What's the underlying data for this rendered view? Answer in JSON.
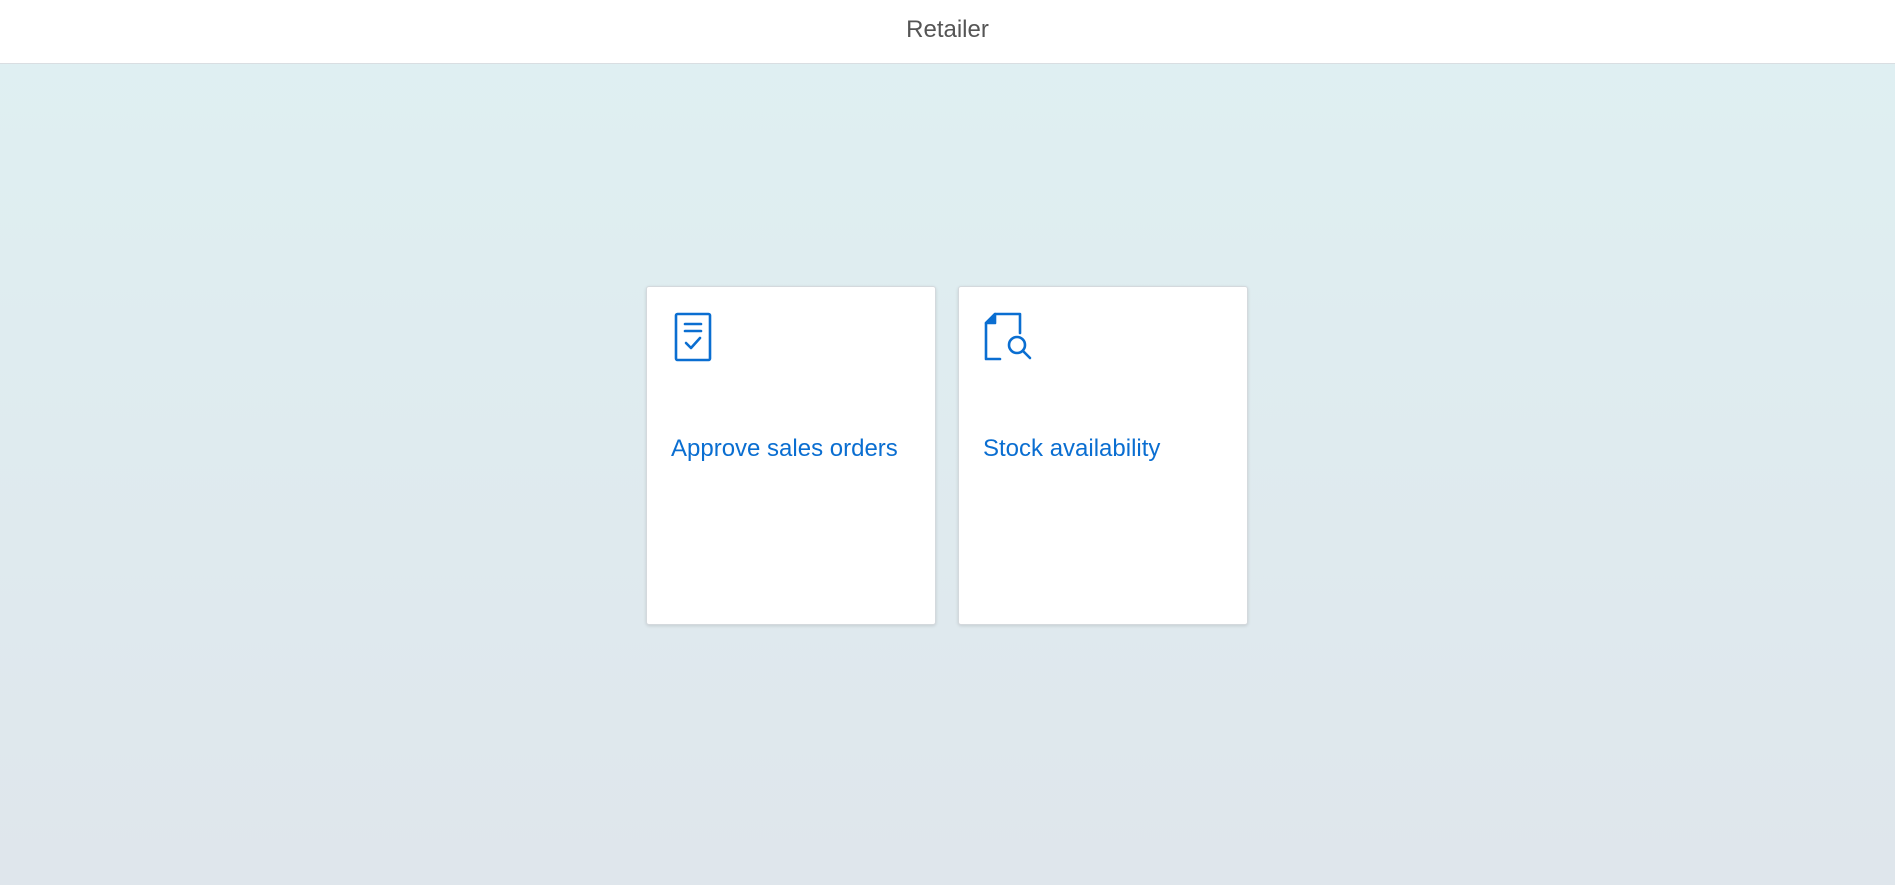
{
  "header": {
    "title": "Retailer"
  },
  "colors": {
    "accent": "#0a6ed1",
    "header_text": "#555555",
    "background_top": "#dff0f2",
    "background_bottom": "#dfe6ec"
  },
  "tiles": [
    {
      "title": "Approve sales orders",
      "icon": "document-checkmark-icon"
    },
    {
      "title": "Stock availability",
      "icon": "document-search-icon"
    }
  ]
}
